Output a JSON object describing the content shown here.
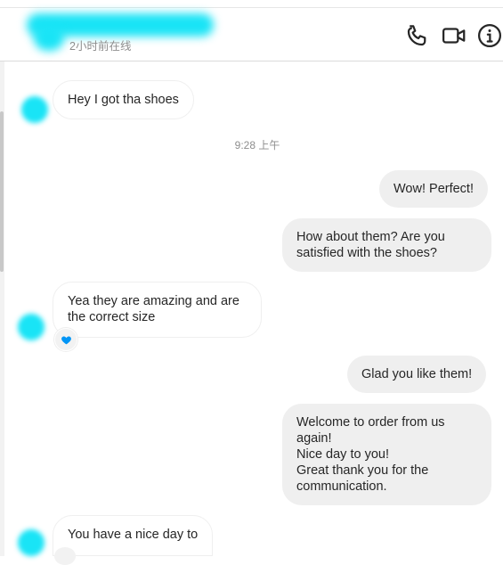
{
  "header": {
    "status": "2小时前在线",
    "icons": [
      "phone-icon",
      "video-camera-icon",
      "info-icon"
    ]
  },
  "timestamp": "9:28 上午",
  "messages": [
    {
      "from": "them",
      "text": "Hey I got tha shoes"
    },
    {
      "from": "me",
      "text": "Wow! Perfect!"
    },
    {
      "from": "me",
      "text": "How about them? Are you\nsatisfied with the shoes?"
    },
    {
      "from": "them",
      "text": "Yea they are amazing and are\nthe correct size",
      "reaction": "heart-icon"
    },
    {
      "from": "me",
      "text": "Glad you like them!"
    },
    {
      "from": "me",
      "text": "Welcome to order from us\nagain!\nNice day to you!\nGreat thank you for the\ncommunication."
    },
    {
      "from": "them",
      "text": "You have a nice day to"
    }
  ],
  "colors": {
    "accent": "#0095f6",
    "redaction": "#19e4f6",
    "outgoing_bubble": "#efefef"
  }
}
